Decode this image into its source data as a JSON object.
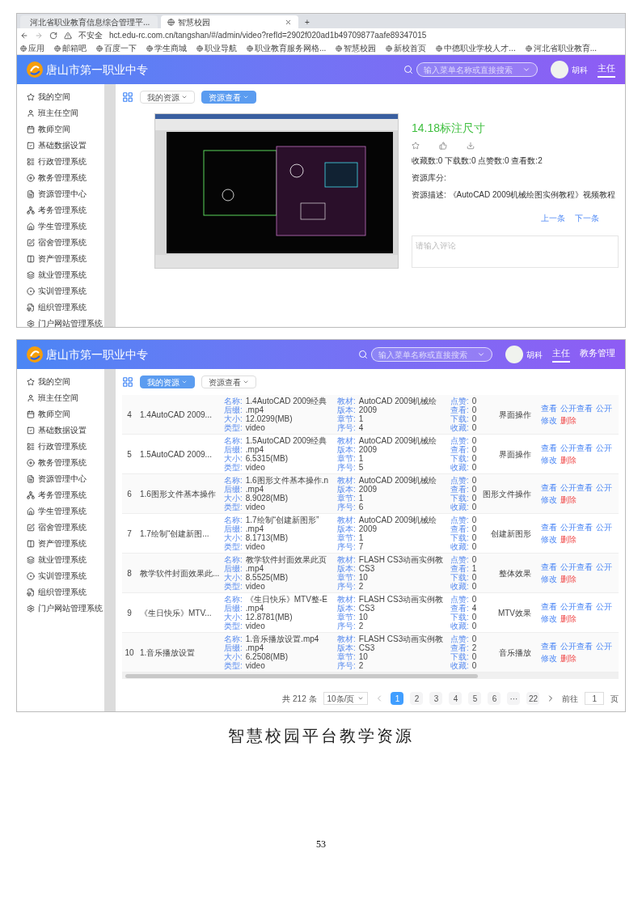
{
  "screenshot_1": {
    "browser": {
      "tabs": [
        {
          "title": "河北省职业教育信息综合管理平...",
          "selected": false
        },
        {
          "title": "智慧校园",
          "selected": true
        }
      ],
      "new_tab": "+",
      "security": "不安全",
      "url": "hct.edu-rc.com.cn/tangshan/#/admin/video?refId=2902f020ad1b49709877aafe89347015",
      "bookmarks": [
        "应用",
        "邮箱吧",
        "百度一下",
        "学生商城",
        "职业导航",
        "职业教育服务网格...",
        "智慧校园",
        "新校首页",
        "中德职业学校人才...",
        "河北省职业教育..."
      ]
    },
    "header": {
      "school_name": "唐山市第一职业中专",
      "search_placeholder": "输入菜单名称或直接搜索",
      "user_name": "胡科",
      "nav": [
        {
          "label": "主任",
          "selected": true
        }
      ]
    },
    "sidebar": [
      "我的空间",
      "班主任空间",
      "教师空间",
      "基础数据设置",
      "行政管理系统",
      "教务管理系统",
      "资源管理中心",
      "考务管理系统",
      "学生管理系统",
      "宿舍管理系统",
      "资产管理系统",
      "就业管理系统",
      "实训管理系统",
      "组织管理系统",
      "门户网站管理系统"
    ],
    "toolbar": [
      {
        "label": "我的资源",
        "selected": false
      },
      {
        "label": "资源查看",
        "selected": true
      }
    ],
    "detail": {
      "title": "14.18标注尺寸",
      "stats": "收藏数:0 下载数:0 点赞数:0 查看数:2",
      "library_label": "资源库分:",
      "description": "资源描述: 《AutoCAD 2009机械绘图实例教程》视频教程",
      "prev": "上一条",
      "next": "下一条",
      "comment_placeholder": "请输入评论"
    }
  },
  "screenshot_2": {
    "header": {
      "school_name": "唐山市第一职业中专",
      "search_placeholder": "输入菜单名称或直接搜索",
      "user_name": "胡科",
      "nav": [
        {
          "label": "主任",
          "selected": true
        },
        {
          "label": "教务管理",
          "selected": false
        }
      ]
    },
    "sidebar": [
      "我的空间",
      "班主任空间",
      "教师空间",
      "基础数据设置",
      "行政管理系统",
      "教务管理系统",
      "资源管理中心",
      "考务管理系统",
      "学生管理系统",
      "宿舍管理系统",
      "资产管理系统",
      "就业管理系统",
      "实训管理系统",
      "组织管理系统",
      "门户网站管理系统"
    ],
    "toolbar": [
      {
        "label": "我的资源",
        "selected": true
      },
      {
        "label": "资源查看",
        "selected": false
      }
    ],
    "rows": [
      {
        "index": "4",
        "title": "1.4AutoCAD 2009...",
        "info": [
          {
            "label": "名称:",
            "value": "1.4AutoCAD 2009经典"
          },
          {
            "label": "后缀:",
            "value": ".mp4"
          },
          {
            "label": "大小:",
            "value": "12.0299(MB)"
          },
          {
            "label": "类型:",
            "value": "video"
          }
        ],
        "book": [
          {
            "label": "教材:",
            "value": "AutoCAD 2009机械绘"
          },
          {
            "label": "版本:",
            "value": "2009"
          },
          {
            "label": "章节:",
            "value": "1"
          },
          {
            "label": "序号:",
            "value": "4"
          }
        ],
        "stats": [
          {
            "label": "点赞:",
            "value": "0"
          },
          {
            "label": "查看:",
            "value": "0"
          },
          {
            "label": "下载:",
            "value": "0"
          },
          {
            "label": "收藏:",
            "value": "0"
          }
        ],
        "category": "界面操作",
        "actions": [
          {
            "label": "查看",
            "kind": "link"
          },
          {
            "label": "公开查看",
            "kind": "link"
          },
          {
            "label": "公开",
            "kind": "link"
          },
          {
            "label": "修改",
            "kind": "link"
          },
          {
            "label": "删除",
            "kind": "danger"
          }
        ]
      },
      {
        "index": "5",
        "title": "1.5AutoCAD 2009...",
        "info": [
          {
            "label": "名称:",
            "value": "1.5AutoCAD 2009经典"
          },
          {
            "label": "后缀:",
            "value": ".mp4"
          },
          {
            "label": "大小:",
            "value": "6.5315(MB)"
          },
          {
            "label": "类型:",
            "value": "video"
          }
        ],
        "book": [
          {
            "label": "教材:",
            "value": "AutoCAD 2009机械绘"
          },
          {
            "label": "版本:",
            "value": "2009"
          },
          {
            "label": "章节:",
            "value": "1"
          },
          {
            "label": "序号:",
            "value": "5"
          }
        ],
        "stats": [
          {
            "label": "点赞:",
            "value": "0"
          },
          {
            "label": "查看:",
            "value": "0"
          },
          {
            "label": "下载:",
            "value": "0"
          },
          {
            "label": "收藏:",
            "value": "0"
          }
        ],
        "category": "界面操作",
        "actions": [
          {
            "label": "查看",
            "kind": "link"
          },
          {
            "label": "公开查看",
            "kind": "link"
          },
          {
            "label": "公开",
            "kind": "link"
          },
          {
            "label": "修改",
            "kind": "link"
          },
          {
            "label": "删除",
            "kind": "danger"
          }
        ]
      },
      {
        "index": "6",
        "title": "1.6图形文件基本操作",
        "info": [
          {
            "label": "名称:",
            "value": "1.6图形文件基本操作.n"
          },
          {
            "label": "后缀:",
            "value": ".mp4"
          },
          {
            "label": "大小:",
            "value": "8.9028(MB)"
          },
          {
            "label": "类型:",
            "value": "video"
          }
        ],
        "book": [
          {
            "label": "教材:",
            "value": "AutoCAD 2009机械绘"
          },
          {
            "label": "版本:",
            "value": "2009"
          },
          {
            "label": "章节:",
            "value": "1"
          },
          {
            "label": "序号:",
            "value": "6"
          }
        ],
        "stats": [
          {
            "label": "点赞:",
            "value": "0"
          },
          {
            "label": "查看:",
            "value": "0"
          },
          {
            "label": "下载:",
            "value": "0"
          },
          {
            "label": "收藏:",
            "value": "0"
          }
        ],
        "category": "图形文件操作",
        "actions": [
          {
            "label": "查看",
            "kind": "link"
          },
          {
            "label": "公开查看",
            "kind": "link"
          },
          {
            "label": "公开",
            "kind": "link"
          },
          {
            "label": "修改",
            "kind": "link"
          },
          {
            "label": "删除",
            "kind": "danger"
          }
        ]
      },
      {
        "index": "7",
        "title": "1.7绘制“创建新图...",
        "info": [
          {
            "label": "名称:",
            "value": "1.7绘制“创建新图形”"
          },
          {
            "label": "后缀:",
            "value": ".mp4"
          },
          {
            "label": "大小:",
            "value": "8.1713(MB)"
          },
          {
            "label": "类型:",
            "value": "video"
          }
        ],
        "book": [
          {
            "label": "教材:",
            "value": "AutoCAD 2009机械绘"
          },
          {
            "label": "版本:",
            "value": "2009"
          },
          {
            "label": "章节:",
            "value": "1"
          },
          {
            "label": "序号:",
            "value": "7"
          }
        ],
        "stats": [
          {
            "label": "点赞:",
            "value": "0"
          },
          {
            "label": "查看:",
            "value": "0"
          },
          {
            "label": "下载:",
            "value": "0"
          },
          {
            "label": "收藏:",
            "value": "0"
          }
        ],
        "category": "创建新图形",
        "actions": [
          {
            "label": "查看",
            "kind": "link"
          },
          {
            "label": "公开查看",
            "kind": "link"
          },
          {
            "label": "公开",
            "kind": "link"
          },
          {
            "label": "修改",
            "kind": "link"
          },
          {
            "label": "删除",
            "kind": "danger"
          }
        ]
      },
      {
        "index": "8",
        "title": "教学软件封面效果此...",
        "info": [
          {
            "label": "名称:",
            "value": "教学软件封面效果此页"
          },
          {
            "label": "后缀:",
            "value": ".mp4"
          },
          {
            "label": "大小:",
            "value": "8.5525(MB)"
          },
          {
            "label": "类型:",
            "value": "video"
          }
        ],
        "book": [
          {
            "label": "教材:",
            "value": "FLASH CS3动画实例教"
          },
          {
            "label": "版本:",
            "value": "CS3"
          },
          {
            "label": "章节:",
            "value": "10"
          },
          {
            "label": "序号:",
            "value": "2"
          }
        ],
        "stats": [
          {
            "label": "点赞:",
            "value": "0"
          },
          {
            "label": "查看:",
            "value": "1"
          },
          {
            "label": "下载:",
            "value": "0"
          },
          {
            "label": "收藏:",
            "value": "0"
          }
        ],
        "category": "整体效果",
        "actions": [
          {
            "label": "查看",
            "kind": "link"
          },
          {
            "label": "公开查看",
            "kind": "link"
          },
          {
            "label": "公开",
            "kind": "link"
          },
          {
            "label": "修改",
            "kind": "link"
          },
          {
            "label": "删除",
            "kind": "danger"
          }
        ]
      },
      {
        "index": "9",
        "title": "《生日快乐》MTV...",
        "info": [
          {
            "label": "名称:",
            "value": "《生日快乐》MTV整-E"
          },
          {
            "label": "后缀:",
            "value": ".mp4"
          },
          {
            "label": "大小:",
            "value": "12.8781(MB)"
          },
          {
            "label": "类型:",
            "value": "video"
          }
        ],
        "book": [
          {
            "label": "教材:",
            "value": "FLASH CS3动画实例教"
          },
          {
            "label": "版本:",
            "value": "CS3"
          },
          {
            "label": "章节:",
            "value": "10"
          },
          {
            "label": "序号:",
            "value": "2"
          }
        ],
        "stats": [
          {
            "label": "点赞:",
            "value": "0"
          },
          {
            "label": "查看:",
            "value": "4"
          },
          {
            "label": "下载:",
            "value": "0"
          },
          {
            "label": "收藏:",
            "value": "0"
          }
        ],
        "category": "MTV效果",
        "actions": [
          {
            "label": "查看",
            "kind": "link"
          },
          {
            "label": "公开查看",
            "kind": "link"
          },
          {
            "label": "公开",
            "kind": "link"
          },
          {
            "label": "修改",
            "kind": "link"
          },
          {
            "label": "删除",
            "kind": "danger"
          }
        ]
      },
      {
        "index": "10",
        "title": "1.音乐播放设置",
        "info": [
          {
            "label": "名称:",
            "value": "1.音乐播放设置.mp4"
          },
          {
            "label": "后缀:",
            "value": ".mp4"
          },
          {
            "label": "大小:",
            "value": "6.2508(MB)"
          },
          {
            "label": "类型:",
            "value": "video"
          }
        ],
        "book": [
          {
            "label": "教材:",
            "value": "FLASH CS3动画实例教"
          },
          {
            "label": "版本:",
            "value": "CS3"
          },
          {
            "label": "章节:",
            "value": "10"
          },
          {
            "label": "序号:",
            "value": "2"
          }
        ],
        "stats": [
          {
            "label": "点赞:",
            "value": "0"
          },
          {
            "label": "查看:",
            "value": "2"
          },
          {
            "label": "下载:",
            "value": "0"
          },
          {
            "label": "收藏:",
            "value": "0"
          }
        ],
        "category": "音乐播放",
        "actions": [
          {
            "label": "查看",
            "kind": "link"
          },
          {
            "label": "公开查看",
            "kind": "link"
          },
          {
            "label": "公开",
            "kind": "link"
          },
          {
            "label": "修改",
            "kind": "link"
          },
          {
            "label": "删除",
            "kind": "danger"
          }
        ]
      }
    ],
    "pagination": {
      "total": "共 212 条",
      "page_size": "10条/页",
      "pages": [
        {
          "label": "1",
          "selected": true
        },
        {
          "label": "2",
          "selected": false
        },
        {
          "label": "3",
          "selected": false
        },
        {
          "label": "4",
          "selected": false
        },
        {
          "label": "5",
          "selected": false
        },
        {
          "label": "6",
          "selected": false
        },
        {
          "label": "···",
          "selected": false
        },
        {
          "label": "22",
          "selected": false
        }
      ],
      "goto_label": "前往",
      "goto_value": "1",
      "goto_unit": "页"
    }
  },
  "caption": "智慧校园平台教学资源",
  "page_number": "53"
}
